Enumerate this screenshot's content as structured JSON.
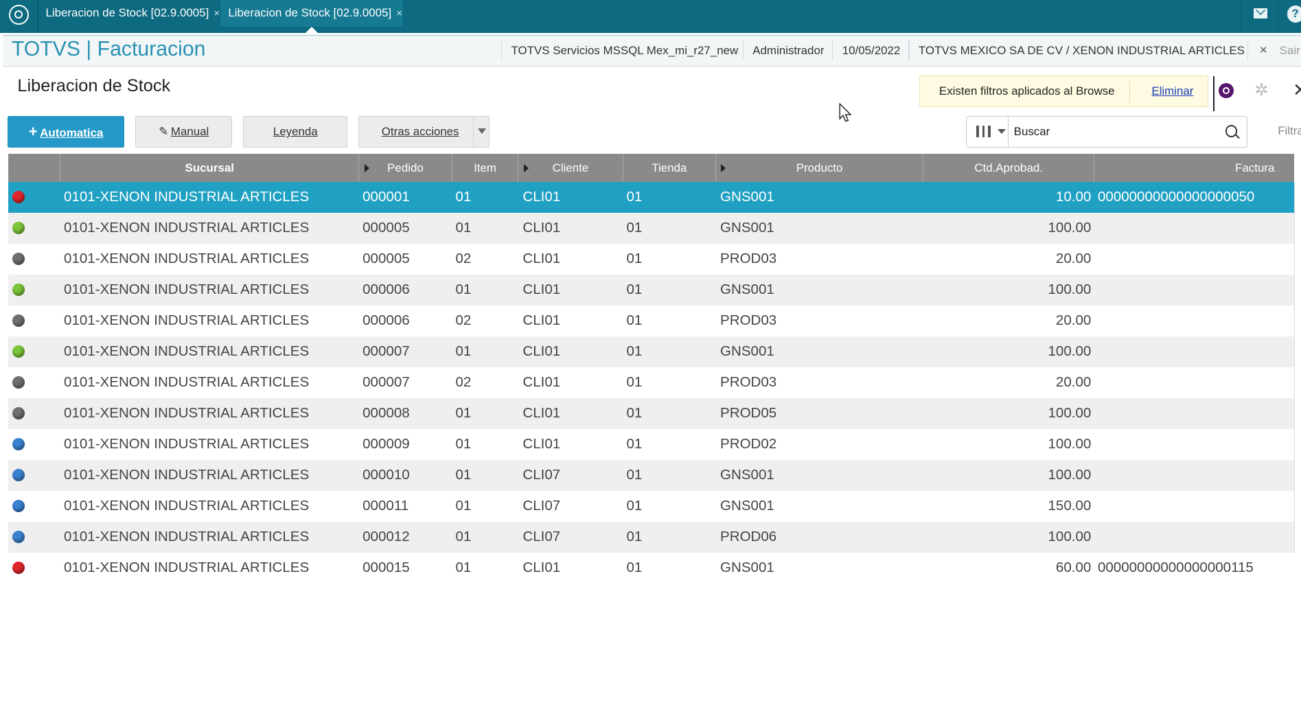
{
  "tabs": [
    {
      "label": "Liberacion de Stock [02.9.0005]",
      "close": "×"
    },
    {
      "label": "Liberacion de Stock [02.9.0005]",
      "close": "×"
    }
  ],
  "header": {
    "title": "TOTVS | Facturacion",
    "environment": "TOTVS Servicios MSSQL Mex_mi_r27_new",
    "user": "Administrador",
    "date": "10/05/2022",
    "company": "TOTVS MEXICO SA DE CV / XENON INDUSTRIAL ARTICLES",
    "exit_label": "Sair",
    "exit_icon": "×"
  },
  "page": {
    "title": "Liberacion de Stock"
  },
  "filter_banner": {
    "message": "Existen filtros aplicados al Browse",
    "remove_label": "Eliminar"
  },
  "toolbar": {
    "automatica_label": "Automatica",
    "automatica_icon": "+",
    "manual_label": "Manual",
    "manual_icon": "✎",
    "leyenda_label": "Leyenda",
    "otras_label": "Otras acciones"
  },
  "search": {
    "placeholder": "Buscar",
    "filter_label": "Filtra"
  },
  "icons": {
    "gear": "✲",
    "close": "✕",
    "help": "?"
  },
  "grid": {
    "columns": [
      "Sucursal",
      "Pedido",
      "Item",
      "Cliente",
      "Tienda",
      "Producto",
      "Ctd.Aprobad.",
      "Factura"
    ],
    "status_colors": {
      "red": "#e0262b",
      "green": "#7cc63a",
      "gray": "#6f6f6f",
      "blue": "#3a82d0"
    },
    "rows": [
      {
        "status": "red",
        "sucursal": "0101-XENON INDUSTRIAL ARTICLES",
        "pedido": "000001",
        "item": "01",
        "cliente": "CLI01",
        "tienda": "01",
        "producto": "GNS001",
        "ctd": "10.00",
        "factura": "00000000000000000050"
      },
      {
        "status": "green",
        "sucursal": "0101-XENON INDUSTRIAL ARTICLES",
        "pedido": "000005",
        "item": "01",
        "cliente": "CLI01",
        "tienda": "01",
        "producto": "GNS001",
        "ctd": "100.00",
        "factura": ""
      },
      {
        "status": "gray",
        "sucursal": "0101-XENON INDUSTRIAL ARTICLES",
        "pedido": "000005",
        "item": "02",
        "cliente": "CLI01",
        "tienda": "01",
        "producto": "PROD03",
        "ctd": "20.00",
        "factura": ""
      },
      {
        "status": "green",
        "sucursal": "0101-XENON INDUSTRIAL ARTICLES",
        "pedido": "000006",
        "item": "01",
        "cliente": "CLI01",
        "tienda": "01",
        "producto": "GNS001",
        "ctd": "100.00",
        "factura": ""
      },
      {
        "status": "gray",
        "sucursal": "0101-XENON INDUSTRIAL ARTICLES",
        "pedido": "000006",
        "item": "02",
        "cliente": "CLI01",
        "tienda": "01",
        "producto": "PROD03",
        "ctd": "20.00",
        "factura": ""
      },
      {
        "status": "green",
        "sucursal": "0101-XENON INDUSTRIAL ARTICLES",
        "pedido": "000007",
        "item": "01",
        "cliente": "CLI01",
        "tienda": "01",
        "producto": "GNS001",
        "ctd": "100.00",
        "factura": ""
      },
      {
        "status": "gray",
        "sucursal": "0101-XENON INDUSTRIAL ARTICLES",
        "pedido": "000007",
        "item": "02",
        "cliente": "CLI01",
        "tienda": "01",
        "producto": "PROD03",
        "ctd": "20.00",
        "factura": ""
      },
      {
        "status": "gray",
        "sucursal": "0101-XENON INDUSTRIAL ARTICLES",
        "pedido": "000008",
        "item": "01",
        "cliente": "CLI01",
        "tienda": "01",
        "producto": "PROD05",
        "ctd": "100.00",
        "factura": ""
      },
      {
        "status": "blue",
        "sucursal": "0101-XENON INDUSTRIAL ARTICLES",
        "pedido": "000009",
        "item": "01",
        "cliente": "CLI01",
        "tienda": "01",
        "producto": "PROD02",
        "ctd": "100.00",
        "factura": ""
      },
      {
        "status": "blue",
        "sucursal": "0101-XENON INDUSTRIAL ARTICLES",
        "pedido": "000010",
        "item": "01",
        "cliente": "CLI07",
        "tienda": "01",
        "producto": "GNS001",
        "ctd": "100.00",
        "factura": ""
      },
      {
        "status": "blue",
        "sucursal": "0101-XENON INDUSTRIAL ARTICLES",
        "pedido": "000011",
        "item": "01",
        "cliente": "CLI07",
        "tienda": "01",
        "producto": "GNS001",
        "ctd": "150.00",
        "factura": ""
      },
      {
        "status": "blue",
        "sucursal": "0101-XENON INDUSTRIAL ARTICLES",
        "pedido": "000012",
        "item": "01",
        "cliente": "CLI07",
        "tienda": "01",
        "producto": "PROD06",
        "ctd": "100.00",
        "factura": ""
      },
      {
        "status": "red",
        "sucursal": "0101-XENON INDUSTRIAL ARTICLES",
        "pedido": "000015",
        "item": "01",
        "cliente": "CLI01",
        "tienda": "01",
        "producto": "GNS001",
        "ctd": "60.00",
        "factura": "00000000000000000115"
      }
    ]
  }
}
